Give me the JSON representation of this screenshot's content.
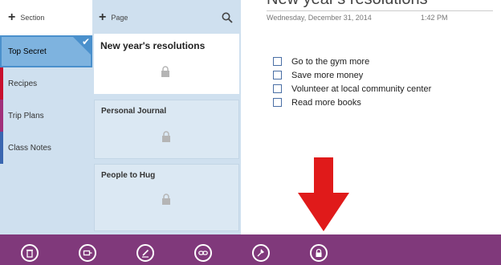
{
  "sections": {
    "add_label": "Section",
    "items": [
      {
        "label": "Top Secret",
        "color": "#4a90cc",
        "selected": true
      },
      {
        "label": "Recipes",
        "color": "#c8102e"
      },
      {
        "label": "Trip Plans",
        "color": "#a0307a"
      },
      {
        "label": "Class Notes",
        "color": "#3a66b0"
      }
    ]
  },
  "pages": {
    "add_label": "Page",
    "items": [
      {
        "title": "New year's resolutions",
        "locked": true,
        "active": true
      },
      {
        "title": "Personal Journal",
        "locked": true
      },
      {
        "title": "People to Hug",
        "locked": true
      }
    ]
  },
  "note": {
    "title": "New year's resolutions",
    "date": "Wednesday, December 31, 2014",
    "time": "1:42 PM",
    "todos": [
      "Go to the gym more",
      "Save more money",
      "Volunteer at local community center",
      "Read more books"
    ]
  },
  "appbar": {
    "color": "#80397b",
    "buttons": [
      "delete-icon",
      "tag-icon",
      "edit-icon",
      "link-icon",
      "pin-icon",
      "lock-icon"
    ]
  },
  "annotation": {
    "arrow_color": "#e01a1a"
  }
}
